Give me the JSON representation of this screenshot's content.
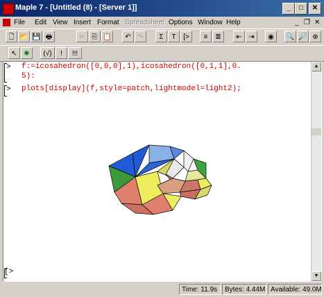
{
  "window": {
    "title": "Maple 7  - [Untitled (8) - [Server 1]]",
    "controls": [
      "_",
      "□",
      "✕"
    ]
  },
  "menu": {
    "items": [
      {
        "label": "File",
        "enabled": true
      },
      {
        "label": "Edit",
        "enabled": true
      },
      {
        "label": "View",
        "enabled": true
      },
      {
        "label": "Insert",
        "enabled": true
      },
      {
        "label": "Format",
        "enabled": true
      },
      {
        "label": "Spreadsheet",
        "enabled": false
      },
      {
        "label": "Options",
        "enabled": true
      },
      {
        "label": "Window",
        "enabled": true
      },
      {
        "label": "Help",
        "enabled": true
      }
    ],
    "mdi_controls": [
      "_",
      "❐",
      "✕"
    ]
  },
  "toolbar1": {
    "buttons": [
      "new-file",
      "open-file",
      "save-file",
      "print",
      "cut",
      "copy",
      "paste",
      "undo",
      "redo",
      "sigma",
      "text",
      "math-input",
      "insert-exec-group",
      "insert-section",
      "back",
      "forward",
      "stop",
      "zoom-in",
      "zoom-out",
      "zoom-max"
    ],
    "glyphs": [
      "🗋",
      "📂",
      "💾",
      "🖶",
      "✂",
      "⎘",
      "📋",
      "↶",
      "↷",
      "Σ",
      "T",
      "[>",
      "≡",
      "≣",
      "⇤",
      "⇥",
      "◉",
      "🔍",
      "🔎",
      "⊕"
    ]
  },
  "toolbar2": {
    "buttons": [
      "arrow-left",
      "debug",
      "check-syntax",
      "exclaim",
      "exclaim-all"
    ],
    "glyphs": [
      "↖",
      "✱",
      "(√)",
      "!",
      "!!!"
    ]
  },
  "worksheet": {
    "prompt": ">",
    "lines": [
      "f:=icosahedron([0,0,0],1),icosahedron([0,1,1],0.",
      "5):",
      "plots[display](f,style=patch,lightmodel=light2);"
    ],
    "empty_prompt": "[>"
  },
  "status": {
    "time": "Time: 11.9s",
    "bytes": "Bytes: 4.44M",
    "available": "Available: 49.0M"
  },
  "colors": {
    "face_blue": "#1f5bd4",
    "face_lightblue": "#8ab0e8",
    "face_yellow": "#ecec5c",
    "face_salmon": "#e0806c",
    "face_green": "#3fa33f",
    "face_pink": "#d8a080",
    "input_red": "#d00000"
  }
}
